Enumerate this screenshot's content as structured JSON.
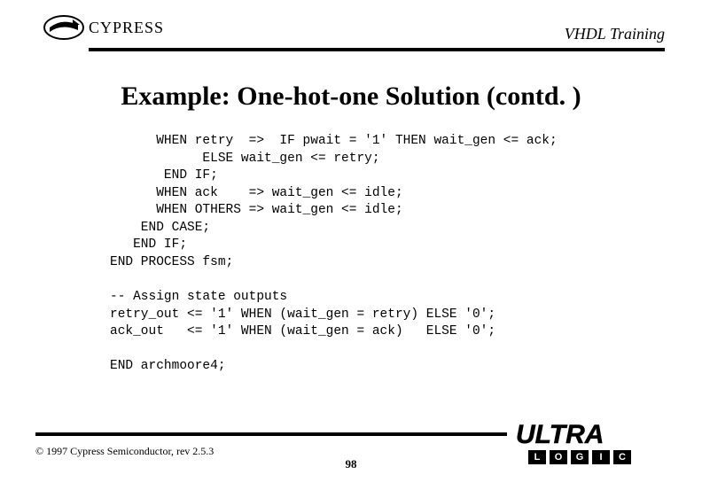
{
  "header": {
    "company": "CYPRESS",
    "series_title": "VHDL Training"
  },
  "slide": {
    "title": "Example: One-hot-one Solution (contd. )",
    "code": "      WHEN retry  =>  IF pwait = '1' THEN wait_gen <= ack;\n            ELSE wait_gen <= retry;\n       END IF;\n      WHEN ack    => wait_gen <= idle;\n      WHEN OTHERS => wait_gen <= idle;\n    END CASE;\n   END IF;\nEND PROCESS fsm;\n\n-- Assign state outputs\nretry_out <= '1' WHEN (wait_gen = retry) ELSE '0';\nack_out   <= '1' WHEN (wait_gen = ack)   ELSE '0';\n\nEND archmoore4;"
  },
  "footer": {
    "copyright": "© 1997 Cypress Semiconductor, rev 2.5.3",
    "page_number": "98",
    "brand_name": "ULTRA",
    "brand_letters": [
      "L",
      "O",
      "G",
      "I",
      "C"
    ]
  }
}
